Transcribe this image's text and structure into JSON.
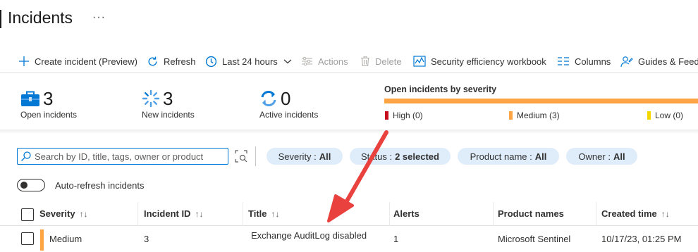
{
  "page": {
    "title": "Incidents",
    "more_label": "···"
  },
  "toolbar": {
    "create_incident": "Create incident (Preview)",
    "refresh": "Refresh",
    "time_range": "Last 24 hours",
    "actions": "Actions",
    "delete": "Delete",
    "security_workbook": "Security efficiency workbook",
    "columns": "Columns",
    "guides": "Guides & Feed"
  },
  "summary": {
    "open": {
      "value": "3",
      "label": "Open incidents"
    },
    "new": {
      "value": "3",
      "label": "New incidents"
    },
    "active": {
      "value": "0",
      "label": "Active incidents"
    },
    "severity_chart": {
      "title": "Open incidents by severity",
      "high": "High (0)",
      "medium": "Medium (3)",
      "low": "Low (0)",
      "colors": {
        "high": "#c50f1f",
        "medium": "#ffa444",
        "low": "#f4d600"
      }
    }
  },
  "filters": {
    "search_placeholder": "Search by ID, title, tags, owner or product",
    "severity": {
      "label": "Severity :",
      "value": "All"
    },
    "status": {
      "label": "Status :",
      "value": "2 selected"
    },
    "product": {
      "label": "Product name :",
      "value": "All"
    },
    "owner": {
      "label": "Owner :",
      "value": "All"
    },
    "auto_refresh": "Auto-refresh incidents"
  },
  "table": {
    "columns": {
      "severity": "Severity",
      "incident_id": "Incident ID",
      "title": "Title",
      "alerts": "Alerts",
      "product_names": "Product names",
      "created_time": "Created time"
    },
    "sort_glyph": "↑↓",
    "rows": [
      {
        "severity": "Medium",
        "incident_id": "3",
        "title": "Exchange AuditLog disabled",
        "alerts": "1",
        "product_names": "Microsoft Sentinel",
        "created_time": "10/17/23, 01:25 PM"
      }
    ]
  },
  "colors": {
    "accent": "#0078d4",
    "annotation_arrow": "#e8413e",
    "pill_bg": "#dfecfa"
  }
}
